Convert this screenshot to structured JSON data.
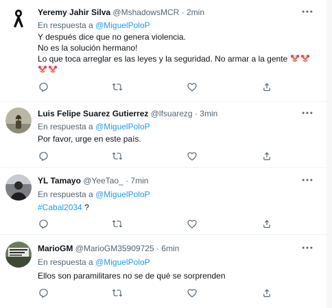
{
  "tweets": [
    {
      "name": "Yeremy Jahir Silva",
      "handle": "@MshadowsMCR",
      "time": "2min",
      "reply_prefix": "En respuesta a",
      "reply_to": "@MiguelPoloP",
      "lines": [
        "Y después dice que no genera violencia.",
        "No es la solución hermano!",
        "Lo que toca arreglar es las leyes y la seguridad. No armar a la gente"
      ],
      "emoji": "clown-face"
    },
    {
      "name": "Luis Felipe Suarez Gutierrez",
      "handle": "@lfsuarezg",
      "time": "3min",
      "reply_prefix": "En respuesta a",
      "reply_to": "@MiguelPoloP",
      "lines": [
        "Por favor, urge en este país."
      ]
    },
    {
      "name": "YL Tamayo",
      "handle": "@YeeTao_",
      "time": "7min",
      "reply_prefix": "En respuesta a",
      "reply_to": "@MiguelPoloP",
      "hashtag": "#Cabal2034",
      "after_hashtag": " ?"
    },
    {
      "name": "MarioGM",
      "handle": "@MarioGM35909725",
      "time": "6min",
      "reply_prefix": "En respuesta a",
      "reply_to": "@MiguelPoloP",
      "lines": [
        "Ellos son paramilitares no se de qué se sorprenden"
      ]
    }
  ],
  "separator": "·",
  "icons": {
    "reply": "comment-icon",
    "retweet": "retweet-icon",
    "like": "heart-icon",
    "share": "share-icon",
    "more": "more-icon"
  },
  "colors": {
    "accent": "#1d9bf0",
    "secondary_text": "#536471",
    "primary_text": "#0f1419",
    "divider": "#eff3f4"
  }
}
